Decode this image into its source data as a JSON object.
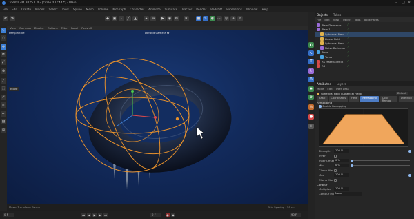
{
  "window": {
    "title": "Cinema 4D 2025.1.0 - [circle 03.c4d *] - Main",
    "controls": [
      "–",
      "□",
      "✕"
    ]
  },
  "menubar": [
    "File",
    "Edit",
    "Create",
    "Modes",
    "Select",
    "Tools",
    "Spline",
    "Mesh",
    "Volume",
    "MoGraph",
    "Character",
    "Animate",
    "Simulate",
    "Tracker",
    "Render",
    "Redshift",
    "Extensions",
    "Window",
    "Help"
  ],
  "layout_tabs": [
    {
      "label": "Startup",
      "active": true
    },
    {
      "label": "UVEdit",
      "active": false
    },
    {
      "label": "Track",
      "active": false
    },
    {
      "label": "Sculpt",
      "active": false
    },
    {
      "label": "Layouts",
      "active": false
    }
  ],
  "viewport": {
    "menu": [
      "View",
      "Cameras",
      "Display",
      "Options",
      "Filter",
      "Panel",
      "Redshift"
    ],
    "label_left": "Perspective",
    "label_center": "Default Camera ✪",
    "side_label": "Move",
    "status_left": "Move: Transform Gizmo",
    "status_right": "Grid Spacing : 50 cm"
  },
  "timeline": {
    "frame_start": "0 F",
    "frame_current": "0 F",
    "frame_end": "90 F"
  },
  "object_manager": {
    "tabs": [
      {
        "label": "Objects",
        "active": true
      },
      {
        "label": "Takes",
        "active": false
      }
    ],
    "menu": [
      "File",
      "Edit",
      "View",
      "Object",
      "Tags",
      "Bookmarks"
    ],
    "objects": [
      {
        "name": "Plain Deformer",
        "indent": 0,
        "color": "#9a6cd8",
        "selected": false
      },
      {
        "name": "Plain.1",
        "indent": 0,
        "color": "#9a6cd8",
        "selected": false
      },
      {
        "name": "Spherical Field",
        "indent": 1,
        "color": "#e0b24c",
        "selected": true
      },
      {
        "name": "Linear Field",
        "indent": 1,
        "color": "#e0b24c",
        "selected": false
      },
      {
        "name": "Spherical Field",
        "indent": 1,
        "color": "#e0b24c",
        "selected": false
      },
      {
        "name": "Noise Deformer",
        "indent": 1,
        "color": "#9a6cd8",
        "selected": false
      },
      {
        "name": "Torus",
        "indent": 0,
        "color": "#4aa3e0",
        "selected": false
      },
      {
        "name": "Torus",
        "indent": 1,
        "color": "#4aa3e0",
        "selected": false
      },
      {
        "name": "RS Material MtlX",
        "indent": 0,
        "color": "#d64a4a",
        "selected": false
      },
      {
        "name": "RS",
        "indent": 0,
        "color": "#d64a4a",
        "selected": false
      }
    ]
  },
  "attributes": {
    "tabs": [
      {
        "label": "Attributes",
        "active": true
      },
      {
        "label": "Layers",
        "active": false
      }
    ],
    "menu": [
      "Mode",
      "Edit",
      "User Data"
    ],
    "object_title": "Spherical Field [Spherical Field]",
    "preset_label": "Default",
    "subtabs": [
      {
        "label": "Basic",
        "active": false
      },
      {
        "label": "Coordinates",
        "active": false
      },
      {
        "label": "Field",
        "active": false
      },
      {
        "label": "Remapping",
        "active": true
      },
      {
        "label": "Color Remap",
        "active": false
      },
      {
        "label": "Direction",
        "active": false
      }
    ],
    "section": "Remapping",
    "enable_label": "Enable Remapping",
    "rows": [
      {
        "label": "Strength",
        "value": "100 %",
        "knob": 1.0
      },
      {
        "label": "Invert",
        "value": "",
        "knob": null
      },
      {
        "label": "Inner Offset",
        "value": "0 %",
        "knob": 0.0
      },
      {
        "label": "Min",
        "value": "0 %",
        "knob": 0.0
      },
      {
        "label": "Clamp Min",
        "value": "",
        "knob": null
      },
      {
        "label": "Max",
        "value": "100 %",
        "knob": 1.0
      },
      {
        "label": "Clamp Max",
        "value": "",
        "knob": null
      }
    ],
    "contour_section": "Contour",
    "contour_rows": [
      {
        "label": "Multiplier",
        "value": "100 %"
      },
      {
        "label": "Contour Mode",
        "value": "None"
      }
    ]
  },
  "colors": {
    "accent_blue": "#3d7fd6",
    "selection": "#2f4767",
    "gizmo_orange": "#e6902c",
    "graph_fill": "#f0a65c",
    "viewport_bg": "#122a5b"
  },
  "icons": [
    "cinema4d-icon",
    "move-icon",
    "rotate-icon",
    "scale-icon",
    "render-icon",
    "cube-icon",
    "pen-icon",
    "field-icon",
    "light-icon",
    "camera-icon",
    "play-icon",
    "record-icon"
  ]
}
